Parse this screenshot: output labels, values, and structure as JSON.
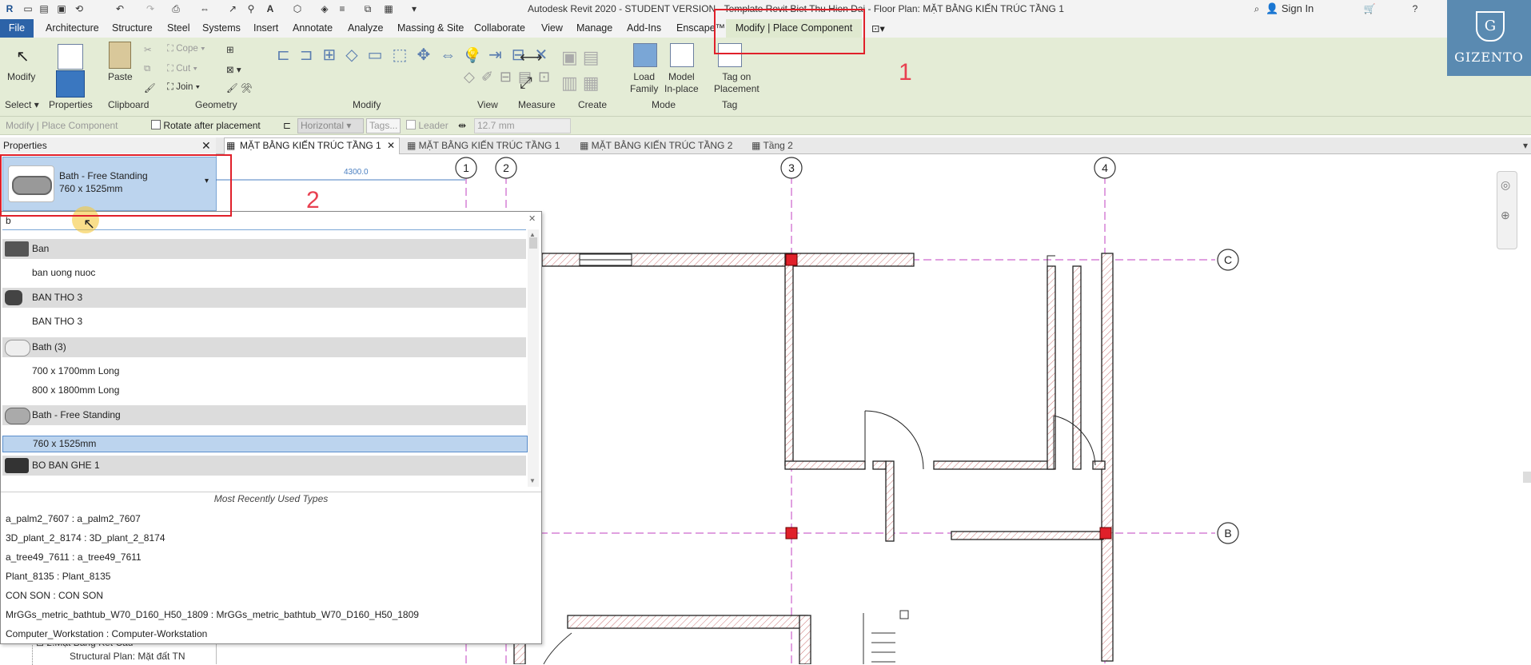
{
  "window": {
    "title": "Autodesk Revit 2020 - STUDENT VERSION - Template Revit Biet Thu Hien Dai - Floor Plan: MẶT BẰNG KIẾN TRÚC TẦNG 1",
    "sign_in": "Sign In",
    "help": "?"
  },
  "ribbon_tabs": [
    "Architecture",
    "Structure",
    "Steel",
    "Systems",
    "Insert",
    "Annotate",
    "Analyze",
    "Massing & Site",
    "Collaborate",
    "View",
    "Manage",
    "Add-Ins",
    "Enscape™"
  ],
  "file_tab": "File",
  "active_context_tab": "Modify | Place Component",
  "ribbon": {
    "modify_label": "Modify",
    "properties_label": "Properties",
    "paste_label": "Paste",
    "cope_label": "Cope",
    "cut_label": "Cut",
    "join_label": "Join",
    "load_family_label": "Load\nFamily",
    "model_inplace_label": "Model\nIn-place",
    "tag_on_placement_label": "Tag on\nPlacement",
    "groups": {
      "select": "Select",
      "properties": "Properties",
      "clipboard": "Clipboard",
      "geometry": "Geometry",
      "modify": "Modify",
      "view": "View",
      "measure": "Measure",
      "create": "Create",
      "mode": "Mode",
      "tag": "Tag"
    }
  },
  "options_bar": {
    "context": "Modify | Place Component",
    "rotate_label": "Rotate after placement",
    "orientation": "Horizontal",
    "tags_placeholder": "Tags...",
    "leader_label": "Leader",
    "length_value": "12.7 mm"
  },
  "properties_panel": {
    "title": "Properties",
    "type_name": "Bath - Free Standing",
    "type_size": "760 x 1525mm"
  },
  "view_tabs": [
    {
      "label": "MẶT BẰNG KIẾN TRÚC TẦNG 1",
      "active": true
    },
    {
      "label": "MẶT BẰNG KIẾN TRÚC TẦNG 1",
      "active": false
    },
    {
      "label": "MẶT BẰNG KIẾN TRÚC TẦNG 2",
      "active": false
    },
    {
      "label": "Tầng 2",
      "active": false
    }
  ],
  "type_search": {
    "query": "b",
    "items": [
      {
        "label": "Ban",
        "kind": "family"
      },
      {
        "label": "ban uong nuoc",
        "kind": "type"
      },
      {
        "label": "BAN THO 3",
        "kind": "family"
      },
      {
        "label": "BAN THO 3",
        "kind": "type"
      },
      {
        "label": "Bath (3)",
        "kind": "family"
      },
      {
        "label": "700 x 1700mm Long",
        "kind": "type"
      },
      {
        "label": "800 x 1800mm Long",
        "kind": "type"
      },
      {
        "label": "Bath - Free Standing",
        "kind": "family"
      },
      {
        "label": "760 x 1525mm",
        "kind": "selected"
      },
      {
        "label": "BO BAN GHE 1",
        "kind": "family"
      }
    ],
    "mru_title": "Most Recently Used Types",
    "mru": [
      "a_palm2_7607 : a_palm2_7607",
      "3D_plant_2_8174 : 3D_plant_2_8174",
      "a_tree49_7611 : a_tree49_7611",
      "Plant_8135 : Plant_8135",
      "CON SON : CON SON",
      "MrGGs_metric_bathtub_W70_D160_H50_1809 : MrGGs_metric_bathtub_W70_D160_H50_1809",
      "Computer_Workstation : Computer-Workstation"
    ]
  },
  "project_browser_tail": {
    "item1": "2.Mặt Bằng Kết Cấu",
    "item2": "Structural Plan: Mặt đất TN"
  },
  "drawing": {
    "dimension": "4300.0",
    "grid_numbers": [
      "1",
      "2",
      "3",
      "4"
    ],
    "grid_letters": [
      "C",
      "B"
    ]
  },
  "annotations": {
    "callout_1": "1",
    "callout_2": "2"
  },
  "logo": {
    "text": "GIZENTO",
    "mark": "G"
  },
  "colors": {
    "file_tab": "#2c63a8",
    "ribbon": "#e4ecd6",
    "selection": "#bcd4ee",
    "highlight_box": "#e0202a",
    "grid_line": "#c040c0",
    "column": "#e0202a"
  }
}
